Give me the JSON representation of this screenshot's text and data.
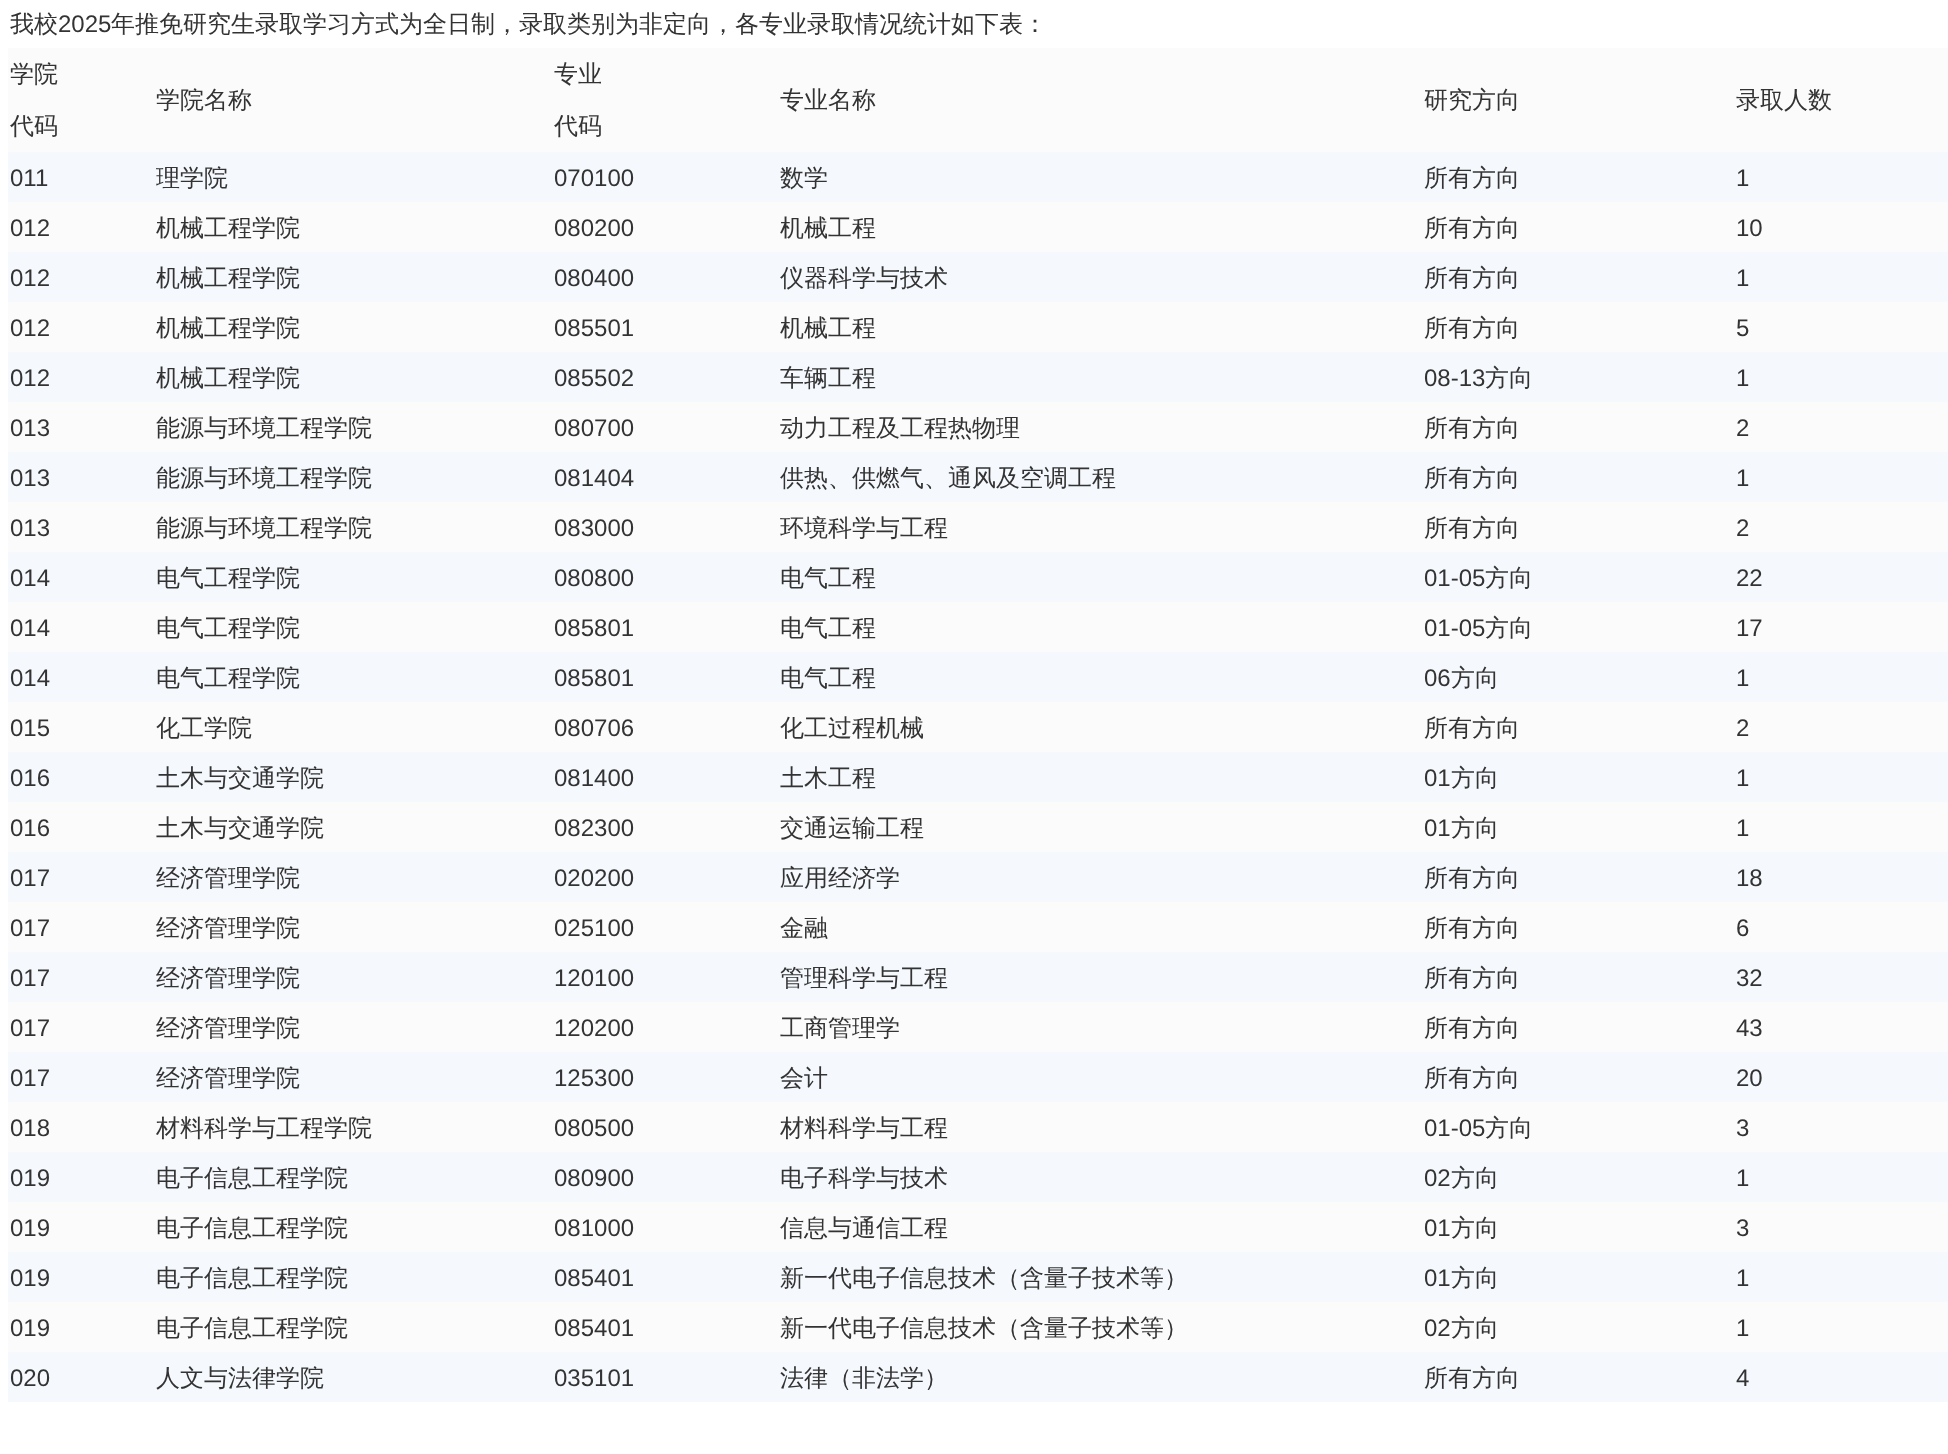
{
  "intro": "我校2025年推免研究生录取学习方式为全日制，录取类别为非定向，各专业录取情况统计如下表：",
  "table": {
    "columns": [
      "学院代码",
      "学院名称",
      "专业代码",
      "专业名称",
      "研究方向",
      "录取人数"
    ],
    "rows": [
      [
        "011",
        "理学院",
        "070100",
        "数学",
        "所有方向",
        "1"
      ],
      [
        "012",
        "机械工程学院",
        "080200",
        "机械工程",
        "所有方向",
        "10"
      ],
      [
        "012",
        "机械工程学院",
        "080400",
        "仪器科学与技术",
        "所有方向",
        "1"
      ],
      [
        "012",
        "机械工程学院",
        "085501",
        "机械工程",
        "所有方向",
        "5"
      ],
      [
        "012",
        "机械工程学院",
        "085502",
        "车辆工程",
        "08-13方向",
        "1"
      ],
      [
        "013",
        "能源与环境工程学院",
        "080700",
        "动力工程及工程热物理",
        "所有方向",
        "2"
      ],
      [
        "013",
        "能源与环境工程学院",
        "081404",
        "供热、供燃气、通风及空调工程",
        "所有方向",
        "1"
      ],
      [
        "013",
        "能源与环境工程学院",
        "083000",
        "环境科学与工程",
        "所有方向",
        "2"
      ],
      [
        "014",
        "电气工程学院",
        "080800",
        "电气工程",
        "01-05方向",
        "22"
      ],
      [
        "014",
        "电气工程学院",
        "085801",
        "电气工程",
        "01-05方向",
        "17"
      ],
      [
        "014",
        "电气工程学院",
        "085801",
        "电气工程",
        "06方向",
        "1"
      ],
      [
        "015",
        "化工学院",
        "080706",
        "化工过程机械",
        "所有方向",
        "2"
      ],
      [
        "016",
        "土木与交通学院",
        "081400",
        "土木工程",
        "01方向",
        "1"
      ],
      [
        "016",
        "土木与交通学院",
        "082300",
        "交通运输工程",
        "01方向",
        "1"
      ],
      [
        "017",
        "经济管理学院",
        "020200",
        "应用经济学",
        "所有方向",
        "18"
      ],
      [
        "017",
        "经济管理学院",
        "025100",
        "金融",
        "所有方向",
        "6"
      ],
      [
        "017",
        "经济管理学院",
        "120100",
        "管理科学与工程",
        "所有方向",
        "32"
      ],
      [
        "017",
        "经济管理学院",
        "120200",
        "工商管理学",
        "所有方向",
        "43"
      ],
      [
        "017",
        "经济管理学院",
        "125300",
        "会计",
        "所有方向",
        "20"
      ],
      [
        "018",
        "材料科学与工程学院",
        "080500",
        "材料科学与工程",
        "01-05方向",
        "3"
      ],
      [
        "019",
        "电子信息工程学院",
        "080900",
        "电子科学与技术",
        "02方向",
        "1"
      ],
      [
        "019",
        "电子信息工程学院",
        "081000",
        "信息与通信工程",
        "01方向",
        "3"
      ],
      [
        "019",
        "电子信息工程学院",
        "085401",
        "新一代电子信息技术（含量子技术等）",
        "01方向",
        "1"
      ],
      [
        "019",
        "电子信息工程学院",
        "085401",
        "新一代电子信息技术（含量子技术等）",
        "02方向",
        "1"
      ],
      [
        "020",
        "人文与法律学院",
        "035101",
        "法律（非法学）",
        "所有方向",
        "4"
      ]
    ]
  }
}
